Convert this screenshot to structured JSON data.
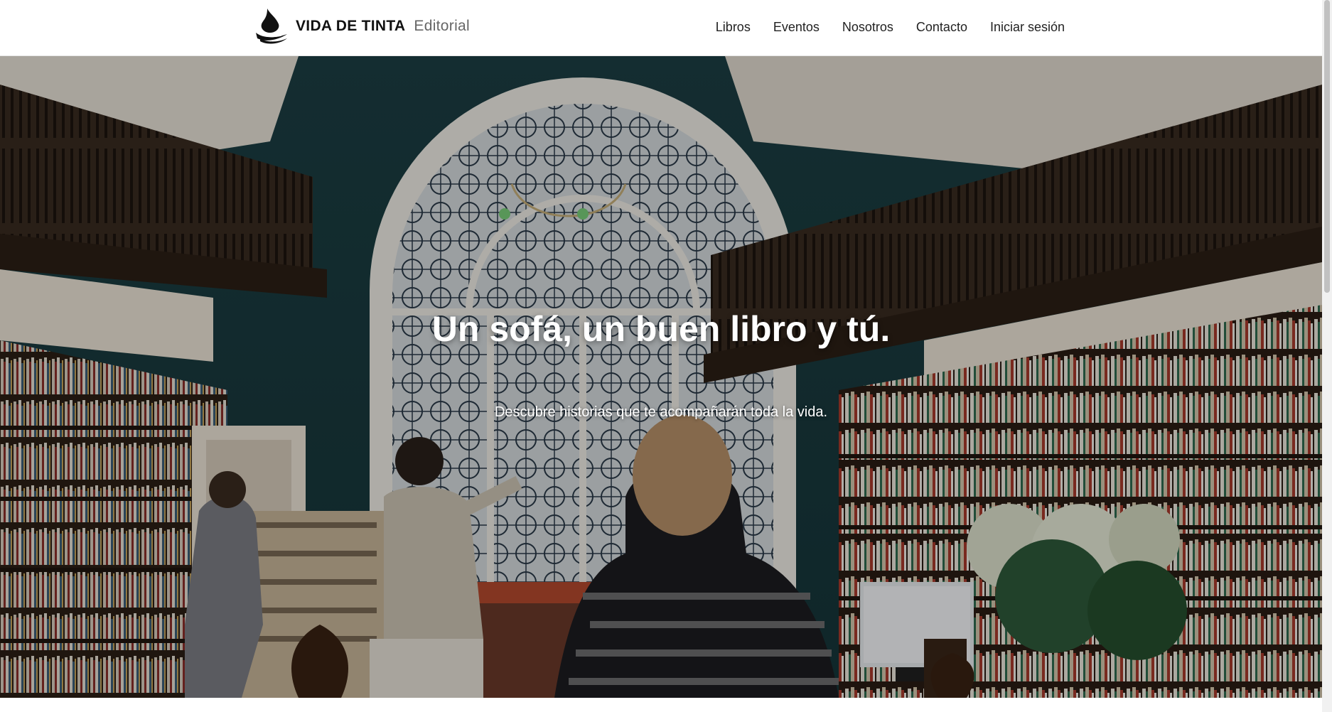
{
  "brand": {
    "name": "VIDA DE TINTA",
    "subtitle": "Editorial",
    "logo_icon": "ink-wave-logo-icon"
  },
  "nav": {
    "items": [
      {
        "label": "Libros"
      },
      {
        "label": "Eventos"
      },
      {
        "label": "Nosotros"
      },
      {
        "label": "Contacto"
      },
      {
        "label": "Iniciar sesión"
      }
    ]
  },
  "hero": {
    "title": "Un sofá, un buen libro y tú.",
    "subtitle": "Descubre historias que te acompañarán toda la vida.",
    "background_image": "bookstore-interior-photo"
  },
  "colors": {
    "header_bg": "#ffffff",
    "text_dark": "#111111",
    "brand_sub": "#666666",
    "hero_text": "#ffffff",
    "wall_teal": "#1f4a4f",
    "wood_dark": "#3a2a1e"
  }
}
